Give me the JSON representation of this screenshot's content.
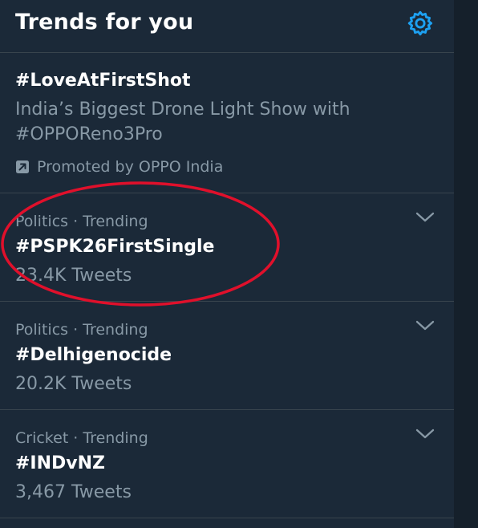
{
  "header": {
    "title": "Trends for you",
    "settings_icon": "gear-icon"
  },
  "promoted": {
    "hashtag": "#LoveAtFirstShot",
    "description": "India’s Biggest Drone Light Show with #OPPOReno3Pro",
    "promoted_by": "Promoted by OPPO India",
    "icon": "promoted-arrow-icon"
  },
  "trends": [
    {
      "meta": "Politics · Trending",
      "hashtag": "#PSPK26FirstSingle",
      "count": "23.4K Tweets"
    },
    {
      "meta": "Politics · Trending",
      "hashtag": "#Delhigenocide",
      "count": "20.2K Tweets"
    },
    {
      "meta": "Cricket · Trending",
      "hashtag": "#INDvNZ",
      "count": "3,467 Tweets"
    }
  ],
  "colors": {
    "background": "#15202b",
    "panel": "#1b2938",
    "accent": "#1da1f2",
    "muted_text": "#8899a6",
    "divider": "#38444d",
    "annotation": "#e0102b"
  },
  "icons": {
    "more": "chevron-down-icon",
    "settings": "gear-icon",
    "promoted": "promoted-arrow-icon"
  }
}
